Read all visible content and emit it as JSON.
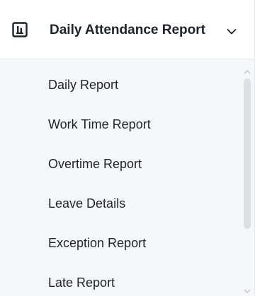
{
  "menu": {
    "header": {
      "title": "Daily Attendance Report",
      "icon": "report-chart-icon",
      "expanded": true
    },
    "items": [
      {
        "label": "Daily Report"
      },
      {
        "label": "Work Time Report"
      },
      {
        "label": "Overtime Report"
      },
      {
        "label": "Leave Details"
      },
      {
        "label": "Exception Report"
      },
      {
        "label": "Late Report"
      }
    ]
  },
  "colors": {
    "submenu_background": "#f4f6f9",
    "text": "#1f2329",
    "scrollbar_thumb": "#dcdfe4"
  }
}
